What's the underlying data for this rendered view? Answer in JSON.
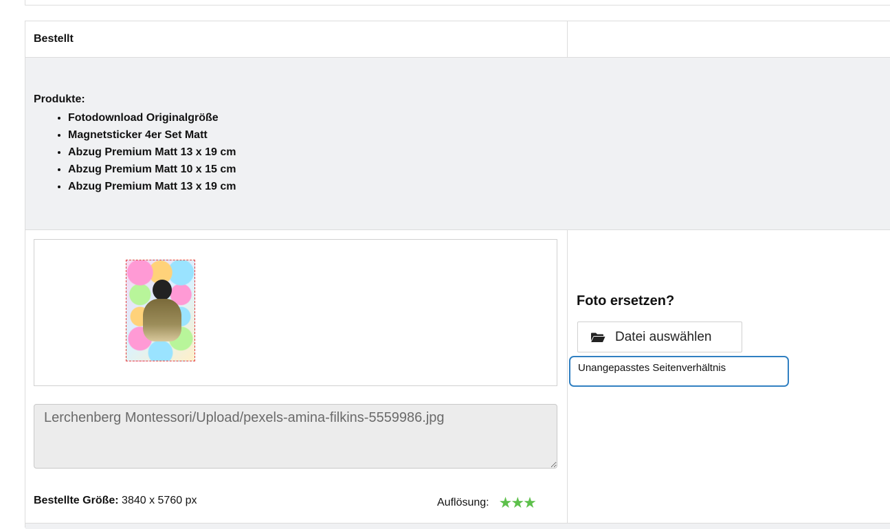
{
  "order_section": {
    "status_title": "Bestellt"
  },
  "products": {
    "label": "Produkte:",
    "items": [
      "Fotodownload Originalgröße",
      "Magnetsticker 4er Set Matt",
      "Abzug Premium Matt 13 x 19 cm",
      "Abzug Premium Matt 10 x 15 cm",
      "Abzug Premium Matt 13 x 19 cm"
    ]
  },
  "photo_panel": {
    "file_path": "Lerchenberg Montessori/Upload/pexels-amina-filkins-5559986.jpg",
    "ordered_size_label": "Bestellte Größe:",
    "ordered_size_value": "3840 x 5760 px",
    "resolution_label": "Auflösung:",
    "resolution_stars": 3
  },
  "replace_panel": {
    "title": "Foto ersetzen?",
    "file_button_label": "Datei auswählen",
    "file_button_icon": "folder-open-icon",
    "warning_text": "Unangepasstes Seitenverhältnis"
  },
  "colors": {
    "star": "#5dc04b",
    "warning_border": "#2f7fc1",
    "crop_border": "#e23b3b"
  }
}
